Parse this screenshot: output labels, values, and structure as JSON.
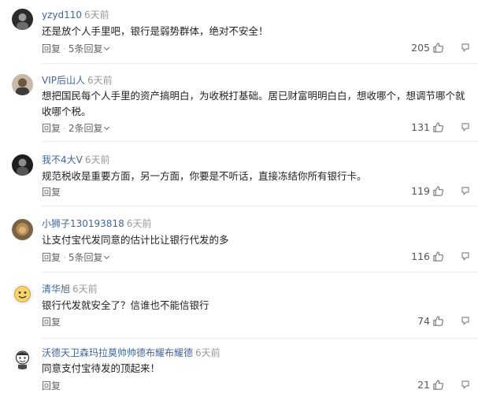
{
  "comments": [
    {
      "username": "yzyd110",
      "time": "6天前",
      "text": "还是放个人手里吧，银行是弱势群体，绝对不安全！",
      "reply_label": "回复",
      "replies_label": "5条回复",
      "likes": "205",
      "avatar_icon": "avatar-dark-photo-icon"
    },
    {
      "username": "VIP后山人",
      "time": "6天前",
      "text": "想把国民每个人手里的资产搞明白，为收税打基础。居已财富明明白白，想收哪个，想调节哪个就收哪个税。",
      "reply_label": "回复",
      "replies_label": "2条回复",
      "likes": "131",
      "avatar_icon": "avatar-person-photo-icon"
    },
    {
      "username": "我不4大V",
      "time": "6天前",
      "text": "规范税收是重要方面，另一方面，你要是不听话，直接冻结你所有银行卡。",
      "reply_label": "回复",
      "replies_label": "",
      "likes": "119",
      "avatar_icon": "avatar-dark-photo-icon"
    },
    {
      "username": "小狮子130193818",
      "time": "6天前",
      "text": "让支付宝代发同意的估计比让银行代发的多",
      "reply_label": "回复",
      "replies_label": "5条回复",
      "likes": "116",
      "avatar_icon": "avatar-lion-photo-icon"
    },
    {
      "username": "清华旭",
      "time": "6天前",
      "text": "银行代发就安全了？信谁也不能信银行",
      "reply_label": "回复",
      "replies_label": "",
      "likes": "74",
      "avatar_icon": "avatar-emoji-icon"
    },
    {
      "username": "沃德天卫森玛拉莫帅帅德布耀布耀德",
      "time": "6天前",
      "text": "同意支付宝待发的顶起来！",
      "reply_label": "回复",
      "replies_label": "",
      "likes": "21",
      "avatar_icon": "avatar-cartoon-icon"
    }
  ],
  "colors": {
    "username": "#406599",
    "time": "#999999",
    "text": "#222222",
    "divider": "#ececec"
  }
}
